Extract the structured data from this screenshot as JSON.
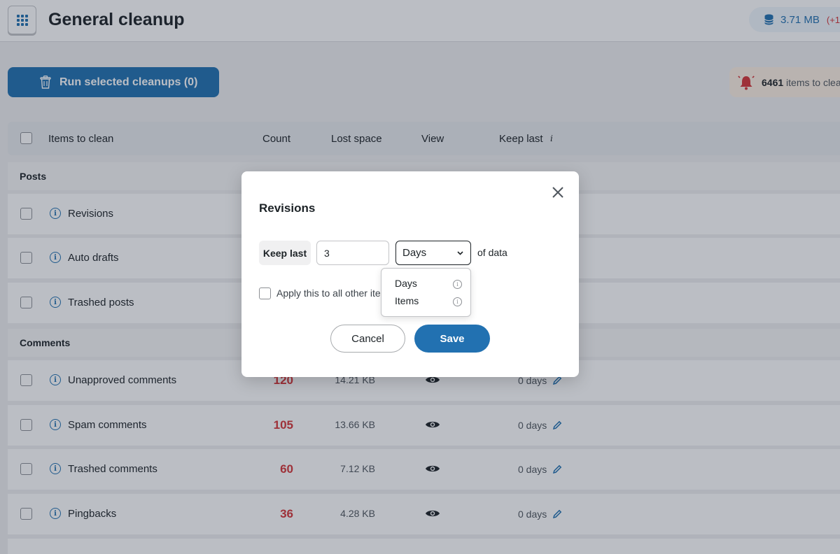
{
  "header": {
    "title": "General cleanup",
    "total_size": "3.71 MB",
    "size_delta": "(+1",
    "apps_icon": "grid-icon",
    "db_icon": "database-icon"
  },
  "toolbar": {
    "run_label": "Run selected cleanups (0)",
    "run_icon": "trash-icon",
    "alert_count": "6461",
    "alert_text": "items to clea",
    "alert_icon": "bell-icon"
  },
  "table": {
    "headers": {
      "items": "Items to clean",
      "count": "Count",
      "lost_space": "Lost space",
      "view": "View",
      "keep_last": "Keep last",
      "keep_last_hint": "i"
    },
    "groups": {
      "posts": "Posts",
      "comments": "Comments"
    },
    "post_rows": [
      {
        "name": "Revisions"
      },
      {
        "name": "Auto drafts"
      },
      {
        "name": "Trashed posts"
      }
    ],
    "comment_rows": [
      {
        "name": "Unapproved comments",
        "count": "120",
        "lost": "14.21 KB",
        "keep": "0 days"
      },
      {
        "name": "Spam comments",
        "count": "105",
        "lost": "13.66 KB",
        "keep": "0 days"
      },
      {
        "name": "Trashed comments",
        "count": "60",
        "lost": "7.12 KB",
        "keep": "0 days"
      },
      {
        "name": "Pingbacks",
        "count": "36",
        "lost": "4.28 KB",
        "keep": "0 days"
      }
    ],
    "info_glyph": "i"
  },
  "modal": {
    "title": "Revisions",
    "keep_label": "Keep last",
    "keep_value": "3",
    "unit_selected": "Days",
    "of_data": "of data",
    "apply_label": "Apply this to all other ite",
    "options": [
      {
        "label": "Days",
        "hint": "i"
      },
      {
        "label": "Items",
        "hint": "i"
      }
    ],
    "cancel_label": "Cancel",
    "save_label": "Save",
    "accent_color": "#2271b1"
  }
}
